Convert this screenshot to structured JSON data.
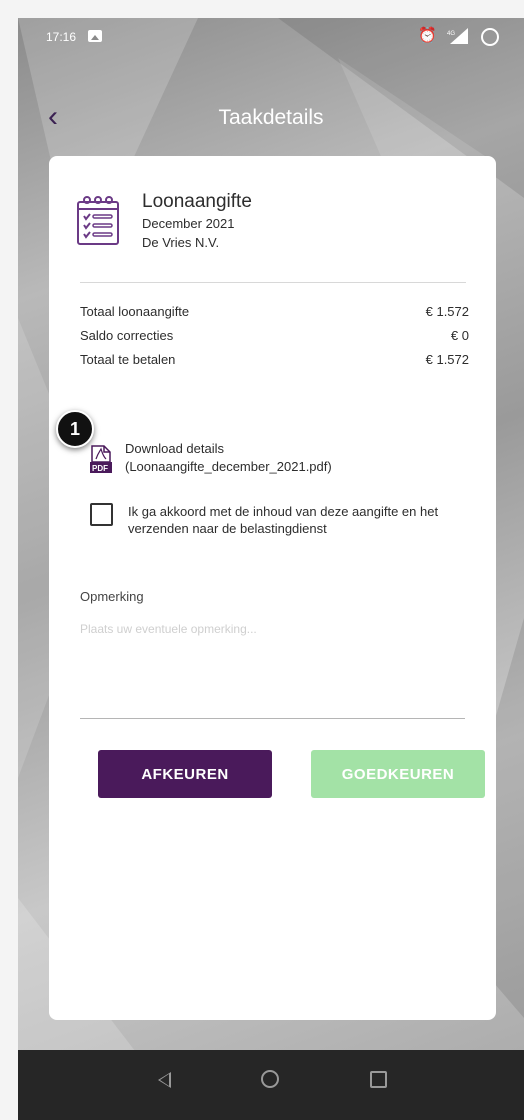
{
  "status_bar": {
    "time": "17:16",
    "network": "4G"
  },
  "header": {
    "title": "Taakdetails"
  },
  "task": {
    "name": "Loonaangifte",
    "period": "December 2021",
    "company": "De Vries N.V."
  },
  "summary": [
    {
      "label": "Totaal loonaangifte",
      "value": "€ 1.572"
    },
    {
      "label": "Saldo correcties",
      "value": "€ 0"
    },
    {
      "label": "Totaal te betalen",
      "value": "€ 1.572"
    }
  ],
  "annotation_badge": "1",
  "download": {
    "label": "Download details",
    "filename": "(Loonaangifte_december_2021.pdf)"
  },
  "agreement_text": "Ik ga akkoord met de inhoud van deze aangifte en het verzenden naar de belastingdienst",
  "remark": {
    "label": "Opmerking",
    "placeholder": "Plaats uw eventuele opmerking...",
    "value": ""
  },
  "buttons": {
    "reject": "AFKEUREN",
    "approve": "GOEDKEUREN"
  },
  "colors": {
    "primary": "#4a1a5b",
    "approve": "#a3e2a6",
    "icon": "#6b3a86"
  }
}
